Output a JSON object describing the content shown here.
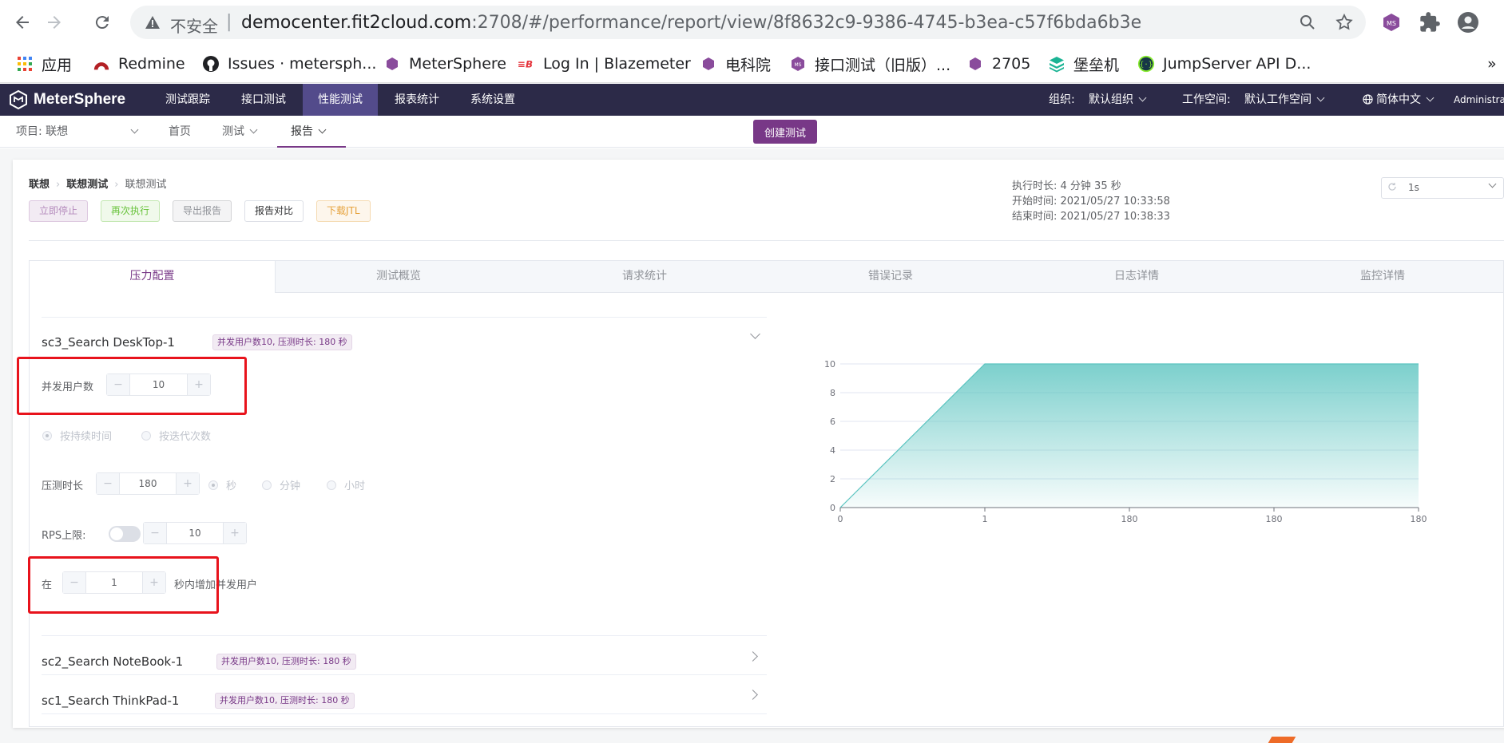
{
  "browser": {
    "insecure_label": "不安全",
    "url_host": "democenter.fit2cloud.com",
    "url_rest": ":2708/#/performance/report/view/8f8632c9-9386-4745-b3ea-c57f6bda6b3e",
    "bookmarks": [
      "应用",
      "Redmine",
      "Issues · metersph...",
      "MeterSphere",
      "Log In | Blazemeter",
      "电科院",
      "接口测试（旧版）...",
      "2705",
      "堡垒机",
      "JumpServer API D..."
    ]
  },
  "header": {
    "logo": "MeterSphere",
    "nav": [
      "测试跟踪",
      "接口测试",
      "性能测试",
      "报表统计",
      "系统设置"
    ],
    "active_nav": "性能测试",
    "org_label": "组织:",
    "org_value": "默认组织",
    "workspace_label": "工作空间:",
    "workspace_value": "默认工作空间",
    "language": "简体中文",
    "user": "Administrat"
  },
  "subnav": {
    "project": "项目: 联想",
    "items": [
      "首页",
      "测试",
      "报告"
    ],
    "active": "报告",
    "create_button": "创建测试"
  },
  "report": {
    "breadcrumb": [
      "联想",
      "联想测试",
      "联想测试"
    ],
    "buttons": {
      "stop": "立即停止",
      "rerun": "再次执行",
      "export": "导出报告",
      "compare": "报告对比",
      "download_jtl": "下载JTL"
    },
    "duration": "执行时长: 4 分钟 35 秒",
    "start_time": "开始时间: 2021/05/27 10:33:58",
    "end_time": "结束时间: 2021/05/27 10:38:33",
    "refresh_interval": "1s"
  },
  "tabs": [
    "压力配置",
    "测试概览",
    "请求统计",
    "错误记录",
    "日志详情",
    "监控详情"
  ],
  "active_tab": "压力配置",
  "scenarios": [
    {
      "name": "sc3_Search DeskTop-1",
      "tag": "并发用户数10, 压测时长: 180 秒",
      "expanded": true
    },
    {
      "name": "sc2_Search NoteBook-1",
      "tag": "并发用户数10, 压测时长: 180 秒",
      "expanded": false
    },
    {
      "name": "sc1_Search ThinkPad-1",
      "tag": "并发用户数10, 压测时长: 180 秒",
      "expanded": false
    }
  ],
  "config": {
    "threads_label": "并发用户数",
    "threads_value": "10",
    "mode_duration": "按持续时间",
    "mode_iterations": "按迭代次数",
    "duration_label": "压测时长",
    "duration_value": "180",
    "unit_sec": "秒",
    "unit_min": "分钟",
    "unit_hour": "小时",
    "rps_label": "RPS上限:",
    "rps_value": "10",
    "rampup_prefix": "在",
    "rampup_value": "1",
    "rampup_suffix": "秒内增加并发用户"
  },
  "colors": {
    "brand": "#783887",
    "header_bg": "#2c2a48",
    "active_nav_bg": "#534b8b",
    "chart_line": "#5bc4c0",
    "highlight_box": "#e8131c"
  },
  "chart_data": {
    "type": "area",
    "categories": [
      "0",
      "1",
      "180",
      "180",
      "180"
    ],
    "values": [
      0,
      10,
      10,
      10,
      10
    ],
    "ylim": [
      0,
      10
    ],
    "yticks": [
      0,
      2,
      4,
      6,
      8,
      10
    ],
    "grid": true
  }
}
